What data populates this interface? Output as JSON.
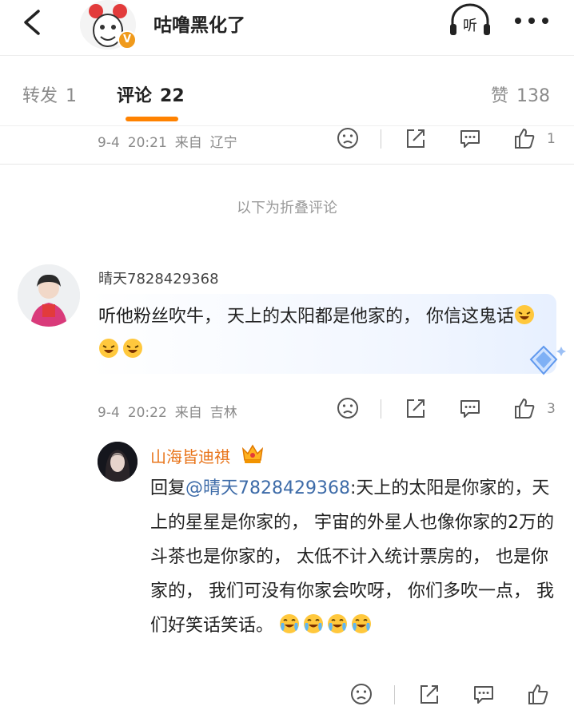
{
  "header": {
    "title": "咕噜黑化了",
    "badge": "V",
    "listen_label": "听"
  },
  "tabs": [
    {
      "label": "转发",
      "count": "1"
    },
    {
      "label": "评论",
      "count": "22"
    },
    {
      "label": "赞",
      "count": "138"
    }
  ],
  "top_row": {
    "date": "9-4",
    "time": "20:21",
    "from": "来自",
    "location": "辽宁",
    "likes": "1"
  },
  "folded_label": "以下为折叠评论",
  "comment": {
    "user": "晴天7828429368",
    "text": "听他粉丝吹牛， 天上的太阳都是他家的， 你信这鬼话",
    "emoji": [
      "laugh-cry-emoji",
      "laugh-cry-emoji",
      "laugh-cry-emoji"
    ],
    "date": "9-4",
    "time": "20:22",
    "from": "来自",
    "location": "吉林",
    "likes": "3"
  },
  "reply": {
    "user": "山海皆迪祺",
    "prefix": "回复",
    "mention": "@晴天7828429368",
    "text": ":天上的太阳是你家的，天上的星星是你家的， 宇宙的外星人也像你家的2万的斗茶也是你家的， 太低不计入统计票房的， 也是你家的， 我们可没有你家会吹呀， 你们多吹一点， 我们好笑话笑话。",
    "emoji": [
      "crying-laughing-emoji",
      "crying-laughing-emoji",
      "crying-laughing-emoji",
      "crying-laughing-emoji"
    ]
  },
  "colors": {
    "accent": "#ff8200",
    "vip_name": "#e8741a",
    "mention": "#3d6ba8"
  }
}
